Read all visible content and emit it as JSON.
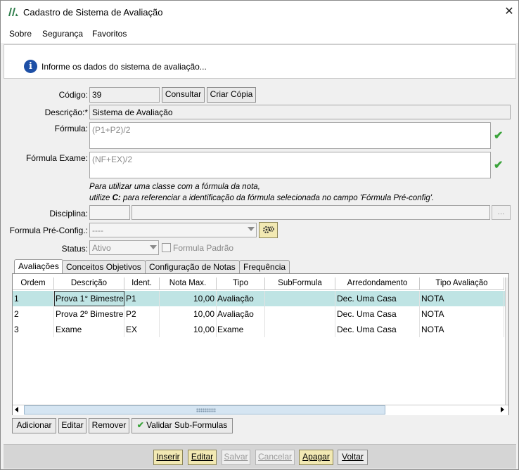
{
  "window": {
    "title": "Cadastro de Sistema de Avaliação",
    "close_glyph": "✕"
  },
  "menu": [
    {
      "label": "Sobre"
    },
    {
      "label": "Segurança"
    },
    {
      "label": "Favoritos"
    }
  ],
  "info": {
    "text": "Informe os dados do sistema de avaliação..."
  },
  "form": {
    "codigo_label": "Código:",
    "codigo_value": "39",
    "consultar_label": "Consultar",
    "criar_copia_label": "Criar Cópia",
    "descricao_label": "Descrição:*",
    "descricao_value": "Sistema de Avaliação",
    "formula_label": "Fórmula:",
    "formula_value": "(P1+P2)/2",
    "formula_exame_label": "Fórmula Exame:",
    "formula_exame_value": "(NF+EX)/2",
    "note_line1": "Para utilizar uma classe com a fórmula da nota,",
    "note_line2_prefix": "utilize ",
    "note_line2_bold": "C:",
    "note_line2_rest": " para referenciar a identificação da fórmula selecionada no campo 'Fórmula Pré-config'.",
    "disciplina_label": "Disciplina:",
    "disciplina_browse": "...",
    "formula_preconfig_label": "Formula Pré-Config.:",
    "formula_preconfig_value": "----",
    "status_label": "Status:",
    "status_value": "Ativo",
    "formula_padrao_label": "Formula Padrão",
    "check_glyph": "✔"
  },
  "tabs": [
    {
      "label": "Avaliações",
      "active": true
    },
    {
      "label": "Conceitos Objetivos",
      "active": false
    },
    {
      "label": "Configuração de Notas",
      "active": false
    },
    {
      "label": "Frequência",
      "active": false
    }
  ],
  "grid": {
    "columns": [
      "Ordem",
      "Descrição",
      "Ident.",
      "Nota Max.",
      "Tipo",
      "SubFormula",
      "Arredondamento",
      "Tipo Avaliação"
    ],
    "rows": [
      {
        "ordem": "1",
        "descricao": "Prova 1° Bimestre",
        "ident": "P1",
        "nota_max": "10,00",
        "tipo": "Avaliação",
        "subformula": "",
        "arredondamento": "Dec. Uma Casa",
        "tipo_avaliacao": "NOTA",
        "selected": true
      },
      {
        "ordem": "2",
        "descricao": "Prova 2º Bimestre",
        "ident": "P2",
        "nota_max": "10,00",
        "tipo": "Avaliação",
        "subformula": "",
        "arredondamento": "Dec. Uma Casa",
        "tipo_avaliacao": "NOTA",
        "selected": false
      },
      {
        "ordem": "3",
        "descricao": "Exame",
        "ident": "EX",
        "nota_max": "10,00",
        "tipo": "Exame",
        "subformula": "",
        "arredondamento": "Dec. Uma Casa",
        "tipo_avaliacao": "NOTA",
        "selected": false
      }
    ]
  },
  "grid_buttons": {
    "adicionar": "Adicionar",
    "editar": "Editar",
    "remover": "Remover",
    "validar": "Validar Sub-Formulas"
  },
  "actions": {
    "inserir": "Inserir",
    "editar": "Editar",
    "salvar": "Salvar",
    "cancelar": "Cancelar",
    "apagar": "Apagar",
    "voltar": "Voltar"
  },
  "colors": {
    "accent_selected_row": "#bfe4e4",
    "yellow_button": "#f2e9b3",
    "check_green": "#3aa33a",
    "info_blue": "#1d4fa6"
  }
}
